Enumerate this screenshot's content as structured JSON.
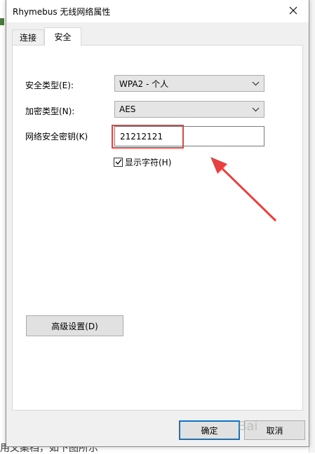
{
  "window": {
    "title": "Rhymebus 无线网络属性"
  },
  "tabs": [
    {
      "label": "连接",
      "active": false
    },
    {
      "label": "安全",
      "active": true
    }
  ],
  "security": {
    "type_label": "安全类型(E):",
    "type_value": "WPA2 - 个人",
    "encryption_label": "加密类型(N):",
    "encryption_value": "AES",
    "key_label": "网络安全密钥(K)",
    "key_value": "21212121",
    "show_chars_label": "显示字符(H)",
    "show_chars_checked": true
  },
  "advanced_button": "高级设置(D)",
  "buttons": {
    "ok": "确定",
    "cancel": "取消"
  },
  "background": {
    "bottom_text": "用文案档，如下图所示",
    "watermark": "Bai"
  },
  "colors": {
    "highlight": "#e8413f",
    "focus": "#0078d7"
  }
}
